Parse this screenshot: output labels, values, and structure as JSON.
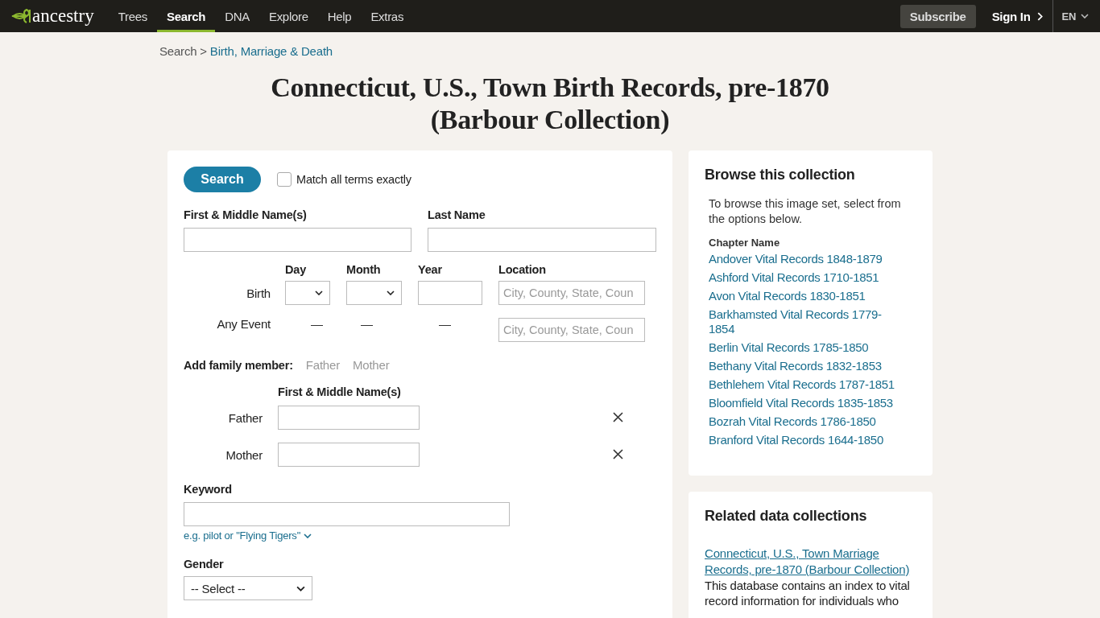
{
  "nav": {
    "logo": "ancestry",
    "items": [
      {
        "label": "Trees",
        "selected": false
      },
      {
        "label": "Search",
        "selected": true
      },
      {
        "label": "DNA",
        "selected": false
      },
      {
        "label": "Explore",
        "selected": false
      },
      {
        "label": "Help",
        "selected": false
      },
      {
        "label": "Extras",
        "selected": false
      }
    ],
    "subscribe": "Subscribe",
    "sign_in": "Sign In",
    "language": "EN"
  },
  "breadcrumb": {
    "root": "Search",
    "separator": ">",
    "link": "Birth, Marriage & Death"
  },
  "title_lines": [
    "Connecticut, U.S., Town Birth Records, pre-1870",
    "(Barbour Collection)"
  ],
  "form": {
    "search_button": "Search",
    "match_exactly": {
      "label": "Match all terms exactly",
      "checked": false
    },
    "first_name": {
      "label": "First & Middle Name(s)"
    },
    "last_name": {
      "label": "Last Name"
    },
    "event_columns": [
      "Day",
      "Month",
      "Year",
      "Location"
    ],
    "events": [
      {
        "label": "Birth",
        "kind": "full",
        "location_placeholder": "City, County, State, Coun"
      },
      {
        "label": "Any Event",
        "kind": "location-only",
        "dashes": [
          "—",
          "—",
          "—"
        ],
        "location_placeholder": "City, County, State, Coun"
      }
    ],
    "add_family": {
      "label": "Add family member:",
      "links": [
        "Father",
        "Mother"
      ]
    },
    "family_column": "First & Middle Name(s)",
    "family_members": [
      {
        "label": "Father"
      },
      {
        "label": "Mother"
      }
    ],
    "keyword": {
      "label": "Keyword",
      "hint": "e.g. pilot or \"Flying Tigers\""
    },
    "gender": {
      "label": "Gender",
      "value": "-- Select --"
    }
  },
  "browse": {
    "title": "Browse this collection",
    "intro": "To browse this image set, select from the options below.",
    "column_header": "Chapter Name",
    "chapters": [
      "Andover Vital Records 1848-1879",
      "Ashford Vital Records 1710-1851",
      "Avon Vital Records 1830-1851",
      "Barkhamsted Vital Records 1779-1854",
      "Berlin Vital Records 1785-1850",
      "Bethany Vital Records 1832-1853",
      "Bethlehem Vital Records 1787-1851",
      "Bloomfield Vital Records 1835-1853",
      "Bozrah Vital Records 1786-1850",
      "Branford Vital Records 1644-1850"
    ]
  },
  "related": {
    "title": "Related data collections",
    "items": [
      {
        "link": "Connecticut, U.S., Town Marriage Records, pre-1870 (Barbour Collection)",
        "description": "This database contains an index to vital record information for individuals who"
      }
    ]
  }
}
